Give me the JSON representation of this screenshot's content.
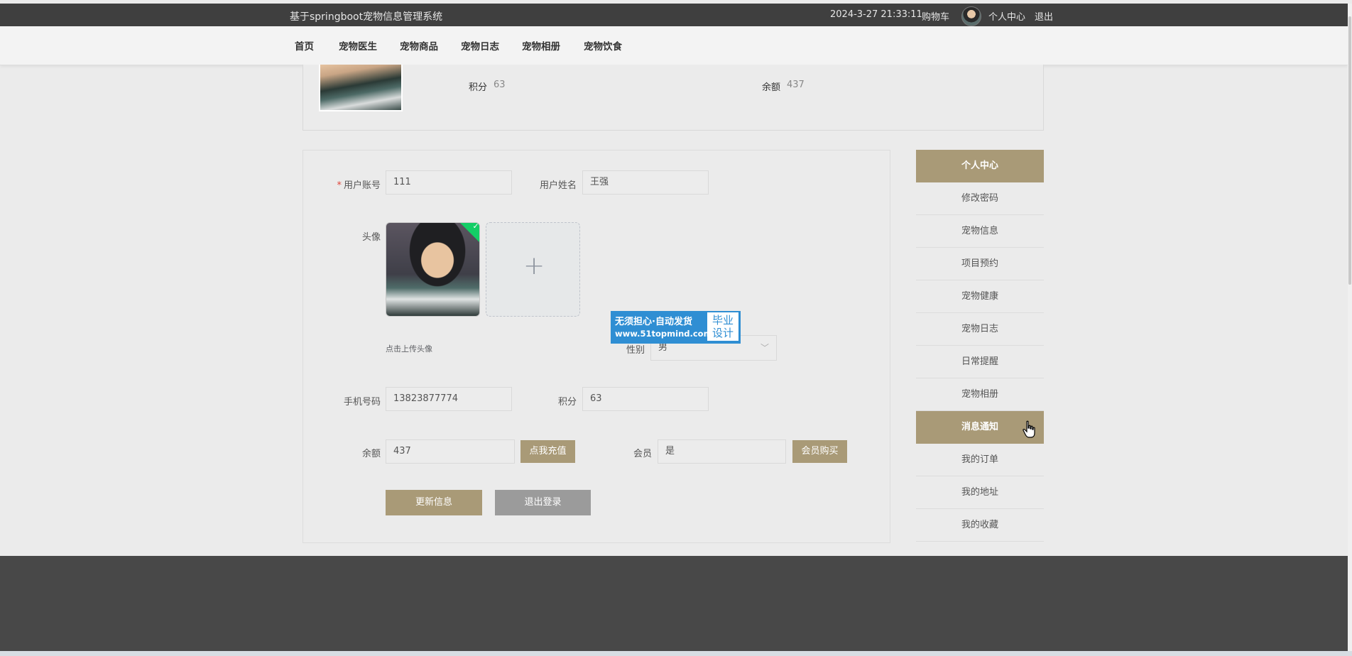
{
  "header": {
    "site_title": "基于springboot宠物信息管理系统",
    "datetime": "2024-3-27 21:33:11",
    "cart": "购物车",
    "user_center": "个人中心",
    "logout": "退出"
  },
  "nav": {
    "items": [
      "首页",
      "宠物医生",
      "宠物商品",
      "宠物日志",
      "宠物相册",
      "宠物饮食"
    ]
  },
  "info_card": {
    "points_label": "积分",
    "points_value": "63",
    "balance_label": "余额",
    "balance_value": "437"
  },
  "form": {
    "account_label": "用户账号",
    "account_value": "111",
    "name_label": "用户姓名",
    "name_value": "王强",
    "avatar_label": "头像",
    "upload_hint": "点击上传头像",
    "gender_label": "性别",
    "gender_value": "男",
    "phone_label": "手机号码",
    "phone_value": "13823877774",
    "points_label": "积分",
    "points_value": "63",
    "balance_label": "余额",
    "balance_value": "437",
    "recharge_button": "点我充值",
    "member_label": "会员",
    "member_value": "是",
    "member_buy_button": "会员购买",
    "update_button": "更新信息",
    "logout_button": "退出登录"
  },
  "watermark": {
    "line1": "无须担心·自动发货",
    "line2": "www.51topmind.com",
    "badge_line1": "毕业",
    "badge_line2": "设计"
  },
  "sidebar": {
    "title": "个人中心",
    "items": [
      "修改密码",
      "宠物信息",
      "项目预约",
      "宠物健康",
      "宠物日志",
      "日常提醒",
      "宠物相册",
      "消息通知",
      "我的订单",
      "我的地址",
      "我的收藏"
    ],
    "active": "消息通知"
  }
}
